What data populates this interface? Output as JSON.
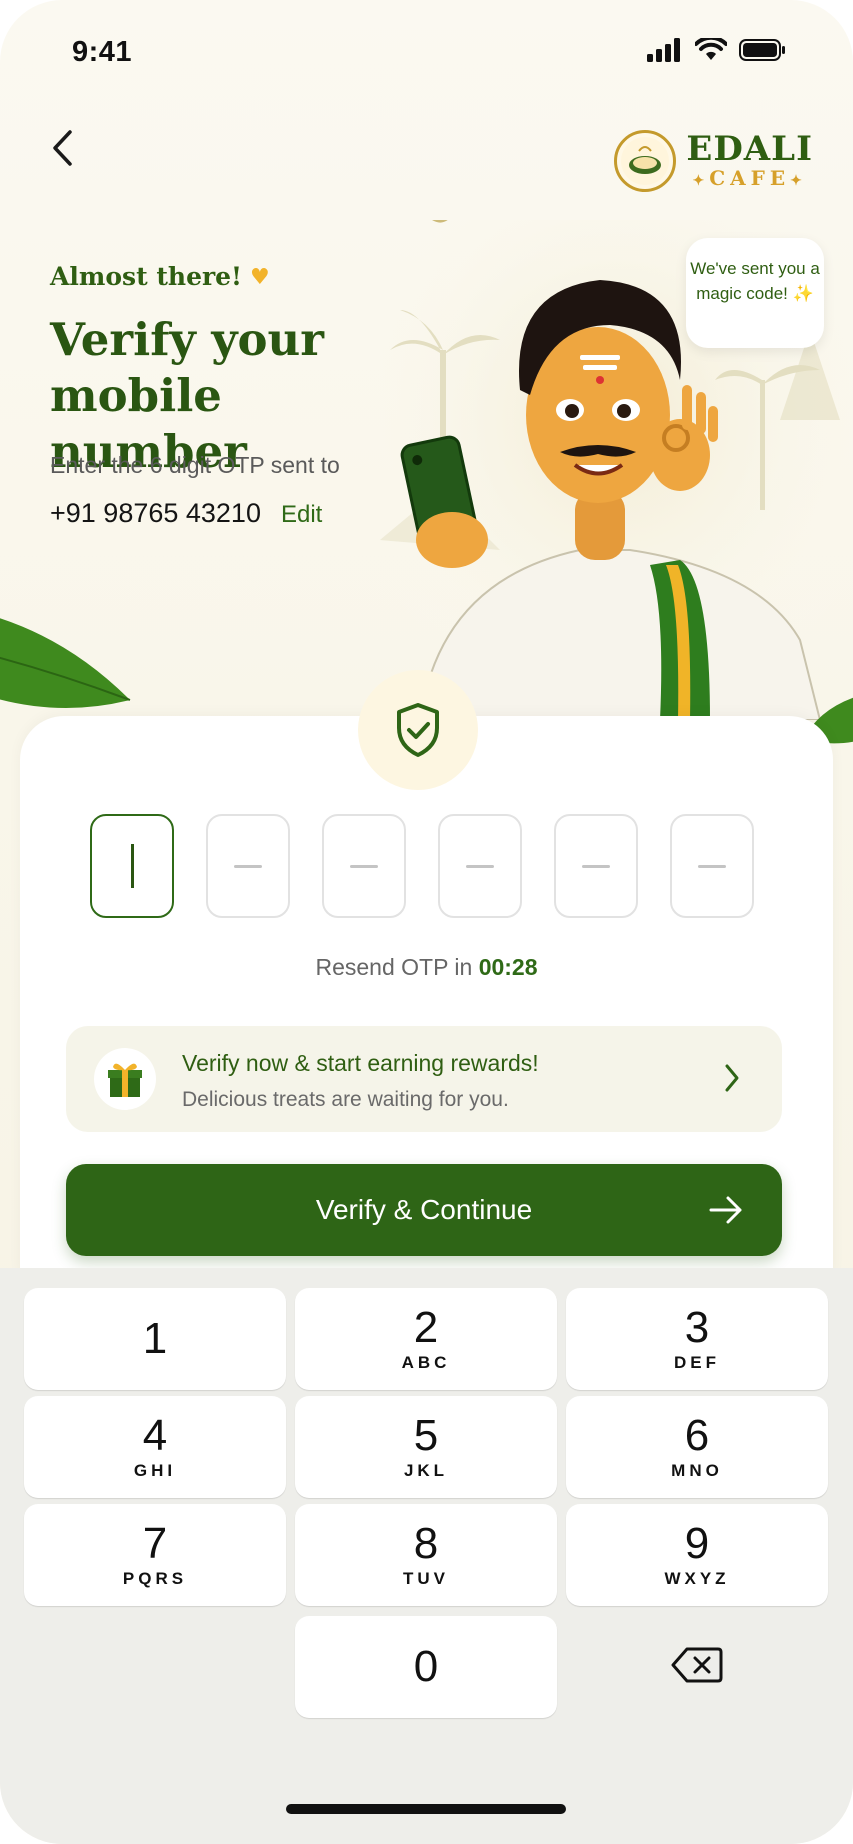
{
  "status": {
    "time": "9:41"
  },
  "brand": {
    "name": "EDALI",
    "sub": "CAFE"
  },
  "hero": {
    "eyebrow": "Almost there!",
    "title": "Verify your mobile number",
    "subtitle": "Enter the 6 digit OTP sent to",
    "phone": "+91 98765 43210",
    "edit": "Edit",
    "bubble": "We've sent you a magic code! ✨"
  },
  "otp": {
    "length": 6,
    "filled": 0
  },
  "resend": {
    "label": "Resend OTP in",
    "timer": "00:28"
  },
  "rewards": {
    "title": "Verify now & start earning rewards!",
    "subtitle": "Delicious treats are waiting for you."
  },
  "verify_button": {
    "label": "Verify & Continue"
  },
  "keypad": [
    {
      "num": "1",
      "letters": ""
    },
    {
      "num": "2",
      "letters": "ABC"
    },
    {
      "num": "3",
      "letters": "DEF"
    },
    {
      "num": "4",
      "letters": "GHI"
    },
    {
      "num": "5",
      "letters": "JKL"
    },
    {
      "num": "6",
      "letters": "MNO"
    },
    {
      "num": "7",
      "letters": "PQRS"
    },
    {
      "num": "8",
      "letters": "TUV"
    },
    {
      "num": "9",
      "letters": "WXYZ"
    },
    {
      "num": "0",
      "letters": ""
    }
  ],
  "colors": {
    "brand_green": "#2e6516",
    "accent_gold": "#d6a02a",
    "background": "#fbf9f1"
  }
}
